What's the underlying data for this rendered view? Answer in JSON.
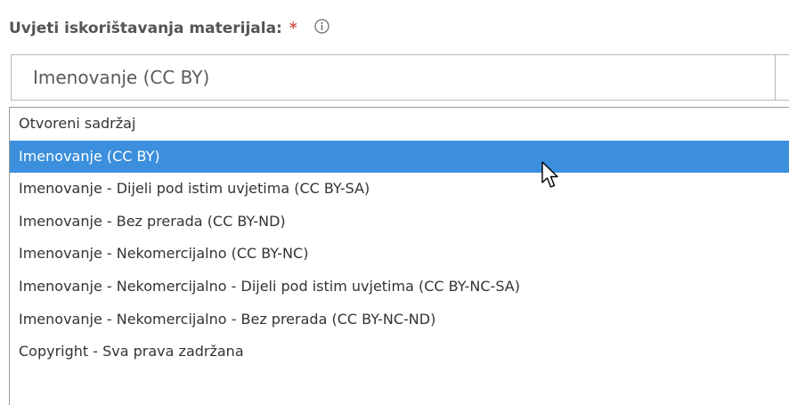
{
  "field": {
    "label": "Uvjeti iskorištavanja materijala:",
    "required_marker": "*",
    "info_icon": "info-circle-icon"
  },
  "select": {
    "selected_value": "Imenovanje (CC BY)",
    "arrow_icon": "chevron-down-icon"
  },
  "dropdown": {
    "selected_index": 1,
    "options": [
      {
        "label": "Otvoreni sadržaj"
      },
      {
        "label": "Imenovanje (CC BY)"
      },
      {
        "label": "Imenovanje - Dijeli pod istim uvjetima (CC BY-SA)"
      },
      {
        "label": "Imenovanje - Bez prerada (CC BY-ND)"
      },
      {
        "label": "Imenovanje - Nekomercijalno (CC BY-NC)"
      },
      {
        "label": "Imenovanje - Nekomercijalno - Dijeli pod istim uvjetima (CC BY-NC-SA)"
      },
      {
        "label": "Imenovanje - Nekomercijalno - Bez prerada (CC BY-NC-ND)"
      },
      {
        "label": "Copyright - Sva prava zadržana"
      }
    ]
  },
  "cursor": {
    "icon": "mouse-pointer-icon"
  },
  "colors": {
    "highlight": "#3b8fdc",
    "required": "#d9534f",
    "label": "#555555",
    "text": "#333333"
  }
}
